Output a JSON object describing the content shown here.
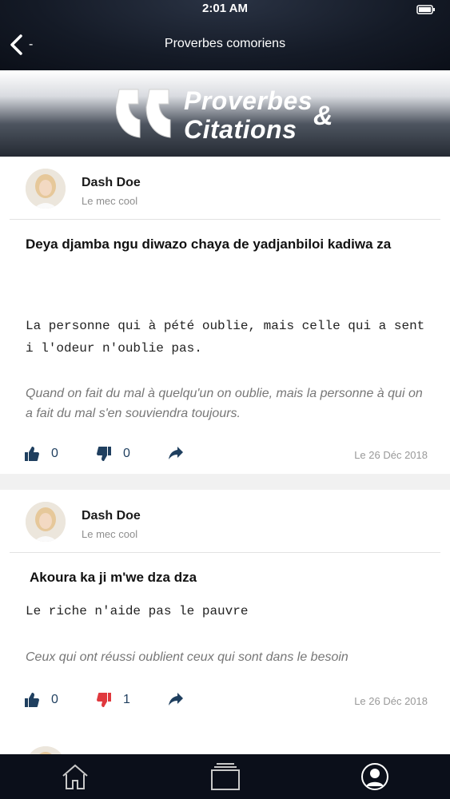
{
  "status_bar": {
    "time": "2:01 AM"
  },
  "nav": {
    "title": "Proverbes comoriens",
    "back_icon": "chevron-left-icon",
    "back_label": "-"
  },
  "banner": {
    "line1": "Proverbes",
    "line2": "Citations",
    "ampersand": "&"
  },
  "posts": [
    {
      "author": "Dash Doe",
      "subtitle": "Le mec cool",
      "proverb": "Deya djamba ngu diwazo chaya de yadjanbiloi kadiwa za",
      "translation": "La personne qui à pété oublie, mais celle qui a senti l'odeur n'oublie pas.",
      "meaning": "Quand on fait du mal à quelqu'un on oublie, mais la personne à qui on a fait du mal s'en souviendra toujours.",
      "likes": "0",
      "dislikes": "0",
      "date": "Le 26 Déc 2018",
      "dislike_color": "#1f3f5f"
    },
    {
      "author": "Dash Doe",
      "subtitle": "Le mec cool",
      "proverb": "Akoura ka ji m'we dza dza",
      "translation": "Le riche n'aide pas le pauvre",
      "meaning": "Ceux qui ont réussi oublient ceux qui sont dans le besoin",
      "likes": "0",
      "dislikes": "1",
      "date": "Le 26 Déc 2018",
      "dislike_color": "#e0393e"
    }
  ],
  "tabbar": {
    "items": [
      "home-icon",
      "cards-icon",
      "profile-icon"
    ]
  },
  "colors": {
    "icon_blue": "#1f3f5f",
    "dislike_active": "#e0393e",
    "bar_bg": "#0b0f1a"
  }
}
